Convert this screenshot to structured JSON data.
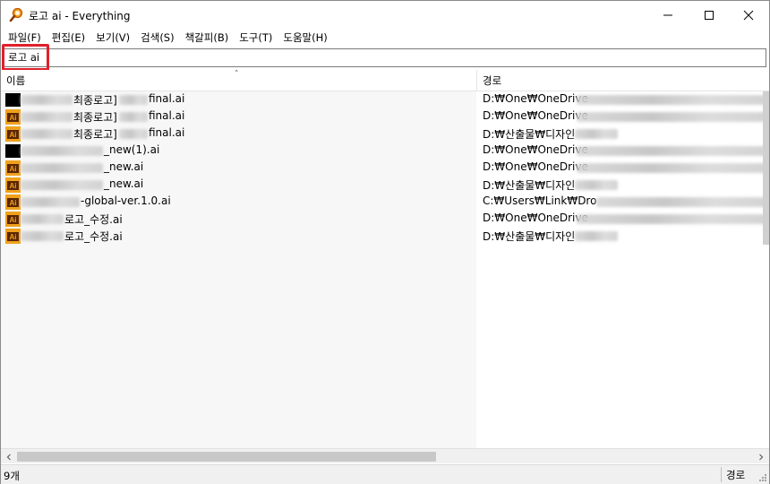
{
  "window": {
    "title": "로고 ai - Everything"
  },
  "menu": {
    "items": [
      "파일(F)",
      "편집(E)",
      "보기(V)",
      "검색(S)",
      "책갈피(B)",
      "도구(T)",
      "도움말(H)"
    ]
  },
  "search": {
    "value": "로고 ai"
  },
  "columns": {
    "name": "이름",
    "path": "경로"
  },
  "results": [
    {
      "icon": "black-file-icon",
      "name": "최종로고]",
      "name2": "final.ai",
      "path": "D:₩One₩OneDrive"
    },
    {
      "icon": "ai-file-icon",
      "name": "최종로고]",
      "name2": "final.ai",
      "path": "D:₩One₩OneDrive"
    },
    {
      "icon": "ai-file-icon",
      "name": "최종로고]",
      "name2": "final.ai",
      "path": "D:₩산출물₩디자인"
    },
    {
      "icon": "black-file-icon",
      "name": "_new(1).ai",
      "name2": "",
      "path": "D:₩One₩OneDrive"
    },
    {
      "icon": "ai-file-icon",
      "name": "_new.ai",
      "name2": "",
      "path": "D:₩One₩OneDrive"
    },
    {
      "icon": "ai-file-icon",
      "name": "_new.ai",
      "name2": "",
      "path": "D:₩산출물₩디자인"
    },
    {
      "icon": "ai-file-icon",
      "name": "-global-ver.1.0.ai",
      "name2": "",
      "path": "C:₩Users₩Link₩Dro"
    },
    {
      "icon": "ai-file-icon",
      "name": "로고_수정.ai",
      "name2": "",
      "path": "D:₩One₩OneDrive"
    },
    {
      "icon": "ai-file-icon",
      "name": "로고_수정.ai",
      "name2": "",
      "path": "D:₩산출물₩디자인"
    }
  ],
  "status": {
    "count": "9개",
    "right": "경로"
  },
  "colors": {
    "highlight": "#e0202a",
    "ai_icon": "#f0a11c",
    "ai_text": "#6e2f00"
  }
}
